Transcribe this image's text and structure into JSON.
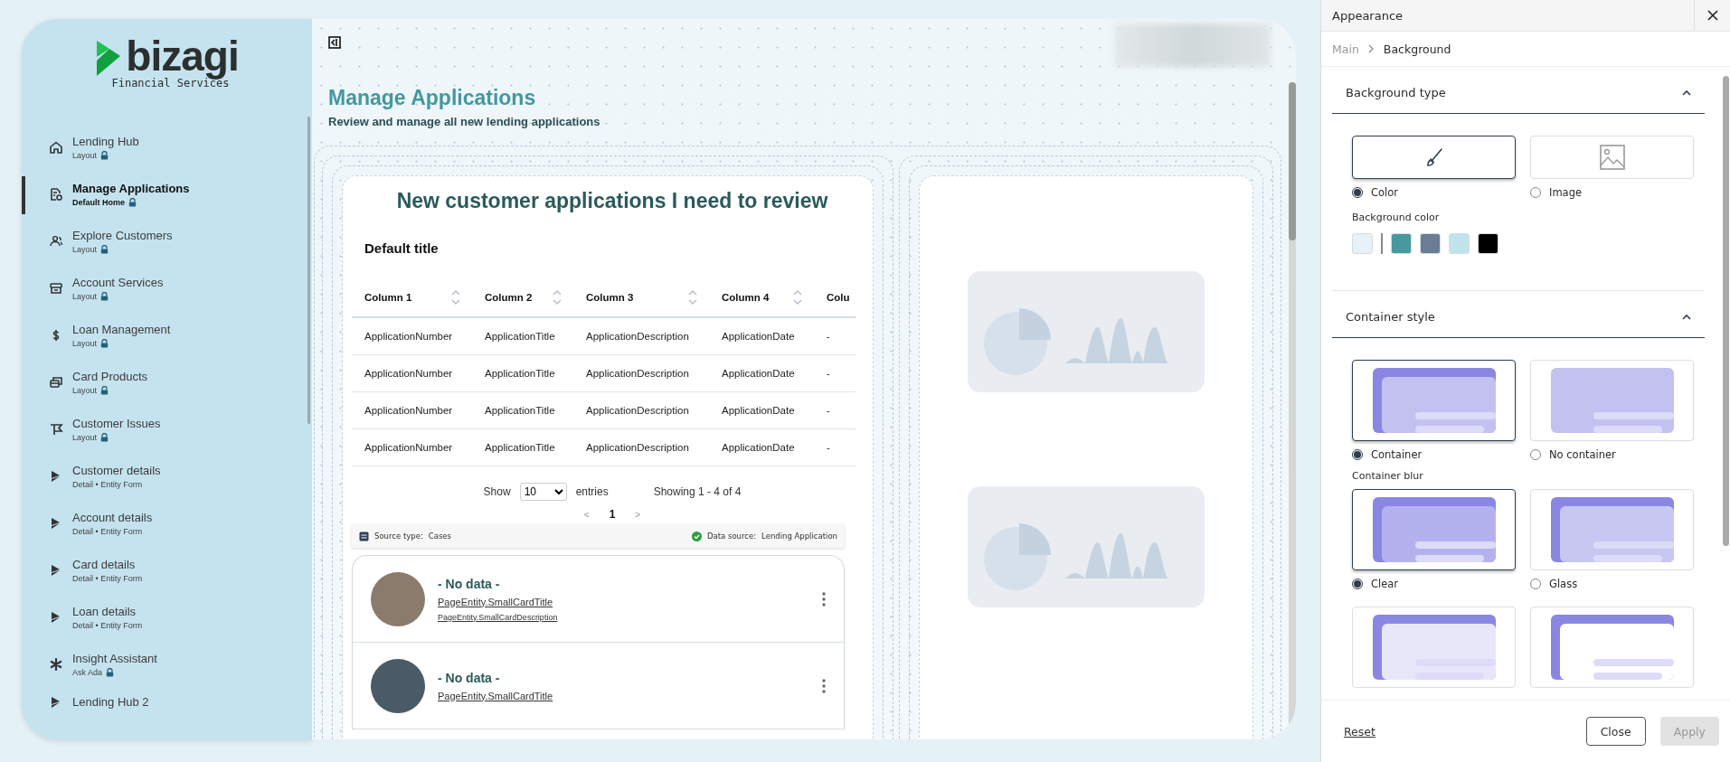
{
  "sidebar": {
    "logo": {
      "brand": "bizagi",
      "tagline": "Financial Services"
    },
    "items": [
      {
        "title": "Lending Hub",
        "subtitle": "Layout",
        "kind": "home",
        "locked": true,
        "selected": false
      },
      {
        "title": "Manage Applications",
        "subtitle": "Default Home",
        "kind": "doc",
        "locked": true,
        "selected": true
      },
      {
        "title": "Explore Customers",
        "subtitle": "Layout",
        "kind": "people",
        "locked": true,
        "selected": false
      },
      {
        "title": "Account Services",
        "subtitle": "Layout",
        "kind": "archive",
        "locked": true,
        "selected": false
      },
      {
        "title": "Loan Management",
        "subtitle": "Layout",
        "kind": "dollar",
        "locked": true,
        "selected": false
      },
      {
        "title": "Card Products",
        "subtitle": "Layout",
        "kind": "cards",
        "locked": true,
        "selected": false
      },
      {
        "title": "Customer Issues",
        "subtitle": "Layout",
        "kind": "flag",
        "locked": true,
        "selected": false
      },
      {
        "title": "Customer details",
        "subtitle": "Detail • Entity Form",
        "kind": "form",
        "locked": false,
        "selected": false
      },
      {
        "title": "Account details",
        "subtitle": "Detail • Entity Form",
        "kind": "form",
        "locked": false,
        "selected": false
      },
      {
        "title": "Card details",
        "subtitle": "Detail • Entity Form",
        "kind": "form",
        "locked": false,
        "selected": false
      },
      {
        "title": "Loan details",
        "subtitle": "Detail • Entity Form",
        "kind": "form",
        "locked": false,
        "selected": false
      },
      {
        "title": "Insight Assistant",
        "subtitle": "Ask Ada",
        "kind": "asterisk",
        "locked": true,
        "selected": false
      },
      {
        "title": "Lending Hub 2",
        "kind": "form",
        "locked": false,
        "selected": false
      }
    ]
  },
  "page": {
    "title": "Manage Applications",
    "subtitle": "Review and manage all new lending applications"
  },
  "widget": {
    "heading": "New customer applications I need to review",
    "table": {
      "title": "Default title",
      "columns": [
        "Column 1",
        "Column 2",
        "Column 3",
        "Column 4",
        "Colu"
      ],
      "rows": [
        [
          "ApplicationNumber",
          "ApplicationTitle",
          "ApplicationDescription",
          "ApplicationDate",
          "-"
        ],
        [
          "ApplicationNumber",
          "ApplicationTitle",
          "ApplicationDescription",
          "ApplicationDate",
          "-"
        ],
        [
          "ApplicationNumber",
          "ApplicationTitle",
          "ApplicationDescription",
          "ApplicationDate",
          "-"
        ],
        [
          "ApplicationNumber",
          "ApplicationTitle",
          "ApplicationDescription",
          "ApplicationDate",
          "-"
        ]
      ]
    },
    "pagination": {
      "show_label": "Show",
      "page_size": "10",
      "entries_label": "entries",
      "summary": "Showing 1 - 4 of 4",
      "prev": "<",
      "page": "1",
      "next": ">"
    },
    "source_bar": {
      "source_label": "Source type:",
      "source_value": "Cases",
      "data_label": "Data source:",
      "data_value": "Lending Application"
    },
    "cards": [
      {
        "title": "- No data -",
        "link": "PageEntity.SmallCardTitle",
        "description": "PageEntity.SmallCardDescription"
      },
      {
        "title": "- No data -",
        "link": "PageEntity.SmallCardTitle"
      }
    ]
  },
  "panel": {
    "title": "Appearance",
    "breadcrumb": {
      "parent": "Main",
      "current": "Background"
    },
    "background_type": {
      "title": "Background type",
      "expanded": true,
      "options": [
        {
          "label": "Color",
          "kind": "brush",
          "selected": true
        },
        {
          "label": "Image",
          "kind": "image",
          "selected": false
        }
      ]
    },
    "background_color": {
      "label": "Background color",
      "swatches": [
        {
          "color": "#e6f2f8"
        },
        {
          "color": "#469a9e"
        },
        {
          "color": "#6a7d94"
        },
        {
          "color": "#c0e3ee"
        },
        {
          "color": "#000000"
        }
      ]
    },
    "container_style": {
      "title": "Container style",
      "expanded": true,
      "options": [
        {
          "label": "Container",
          "kind": "container",
          "selected": true
        },
        {
          "label": "No container",
          "kind": "plain",
          "selected": false
        }
      ]
    },
    "container_blur": {
      "label": "Container blur",
      "options": [
        {
          "label": "Clear",
          "kind": "clear",
          "selected": true
        },
        {
          "label": "Glass",
          "kind": "glass",
          "selected": false
        }
      ],
      "more_options": [
        {
          "kind": "light",
          "selected": false
        },
        {
          "kind": "white",
          "selected": false
        }
      ]
    },
    "footer": {
      "reset": "Reset",
      "close": "Close",
      "apply": {
        "label": "Apply",
        "disabled": true
      }
    }
  }
}
